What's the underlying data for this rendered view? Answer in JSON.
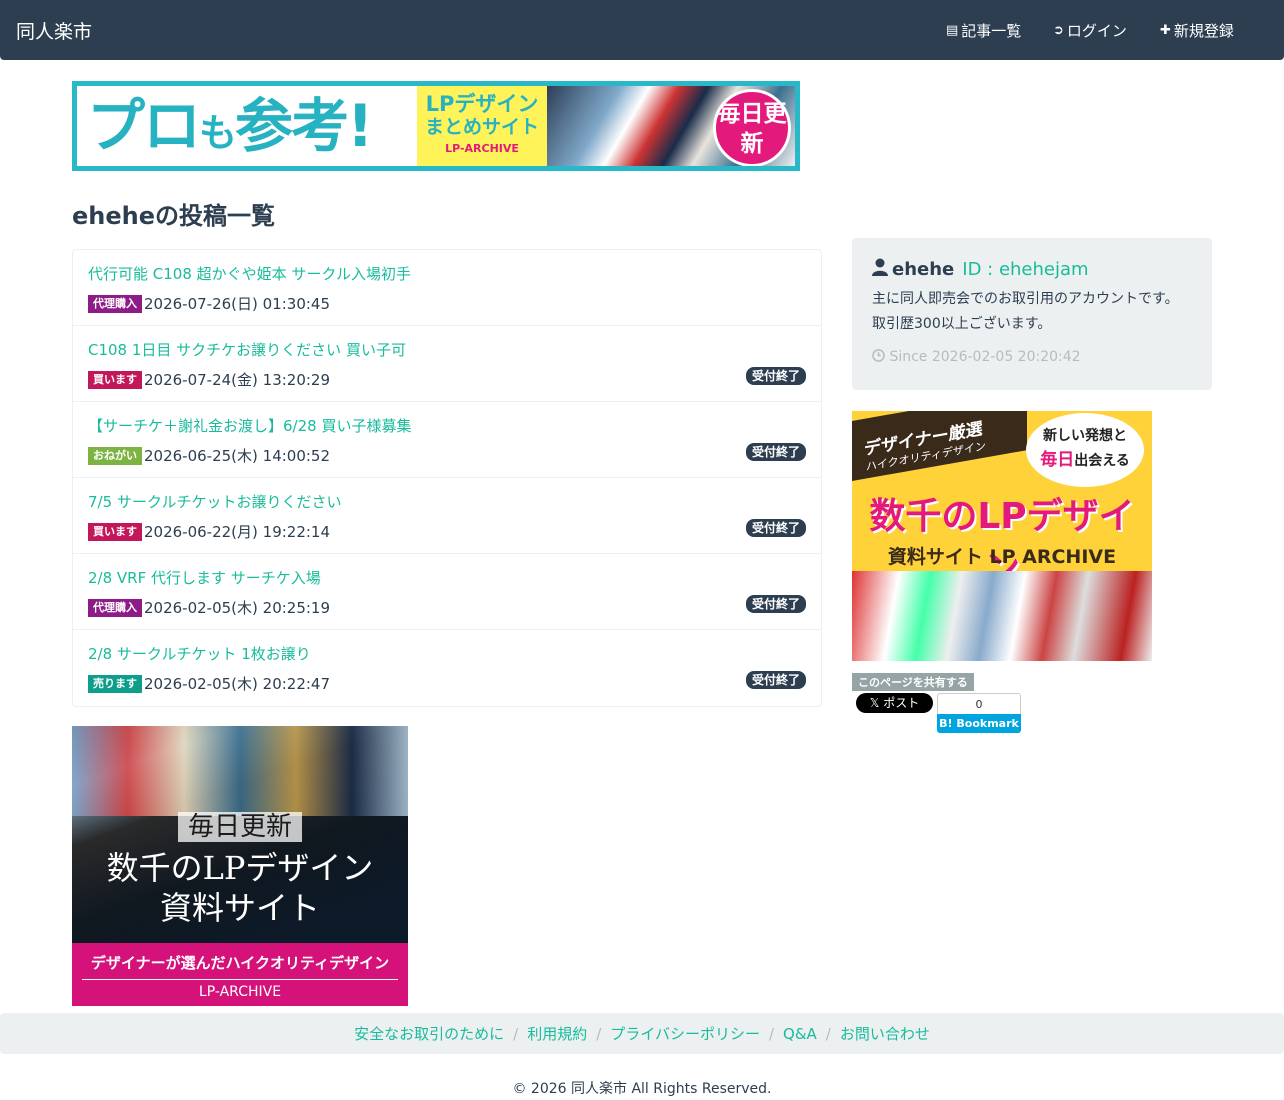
{
  "navbar": {
    "brand": "同人楽市",
    "items": [
      {
        "icon": "list-icon",
        "glyph": "▤",
        "label": "記事一覧"
      },
      {
        "icon": "login-icon",
        "glyph": "➲",
        "label": "ログイン"
      },
      {
        "icon": "plus-icon",
        "glyph": "✚",
        "label": "新規登録"
      }
    ]
  },
  "banner_top": {
    "headline_a": "プロ",
    "headline_b": "も",
    "headline_c": "参考!",
    "line1": "LPデザイン",
    "line2": "まとめサイト",
    "line3": "LP-ARCHIVE",
    "badge": "毎日更新"
  },
  "page_title": "eheheの投稿一覧",
  "posts": [
    {
      "title": "代行可能 C108 超かぐや姫本 サークル入場初手",
      "tag": "代理購入",
      "tag_color": "#8e1b87",
      "date": "2026-07-26(日) 01:30:45",
      "status": ""
    },
    {
      "title": "C108 1日目 サクチケお譲りください 買い子可",
      "tag": "買います",
      "tag_color": "#c2185b",
      "date": "2026-07-24(金) 13:20:29",
      "status": "受付終了"
    },
    {
      "title": "【サーチケ＋謝礼金お渡し】6/28 買い子様募集",
      "tag": "おねがい",
      "tag_color": "#7cb342",
      "date": "2026-06-25(木) 14:00:52",
      "status": "受付終了"
    },
    {
      "title": "7/5 サークルチケットお譲りください",
      "tag": "買います",
      "tag_color": "#c2185b",
      "date": "2026-06-22(月) 19:22:14",
      "status": "受付終了"
    },
    {
      "title": "2/8 VRF 代行します サーチケ入場",
      "tag": "代理購入",
      "tag_color": "#8e1b87",
      "date": "2026-02-05(木) 20:25:19",
      "status": "受付終了"
    },
    {
      "title": "2/8 サークルチケット 1枚お譲り",
      "tag": "売ります",
      "tag_color": "#0f9e8a",
      "date": "2026-02-05(木) 20:22:47",
      "status": "受付終了"
    }
  ],
  "banner_bottom": {
    "line1": "毎日更新",
    "line2": "数千のLPデザイン",
    "line3": "資料サイト",
    "pink1": "デザイナーが選んだハイクオリティデザイン",
    "pink2": "LP-ARCHIVE"
  },
  "profile": {
    "name": "ehehe",
    "id_label": "ID : ehehejam",
    "description": "主に同人即売会でのお取引用のアカウントです。取引歴300以上ございます。",
    "since": "Since 2026-02-05 20:20:42"
  },
  "ad_side": {
    "brown1": "デザイナー厳選",
    "brown2": "ハイクオリティデザイン",
    "bubble1": "新しい発想と",
    "bubble2_em": "毎日",
    "bubble2": "出会える",
    "big": "数千のLPデザイン",
    "sub": "資料サイト LP ARCHIVE"
  },
  "share": {
    "label": "このページを共有する",
    "x_button": "𝕏 ポスト",
    "hatena_count": "0",
    "hatena_button": "B! Bookmark"
  },
  "footer": {
    "links": [
      "安全なお取引のために",
      "利用規約",
      "プライバシーポリシー",
      "Q&A",
      "お問い合わせ"
    ],
    "copyright": "© 2026 同人楽市 All Rights Reserved."
  }
}
